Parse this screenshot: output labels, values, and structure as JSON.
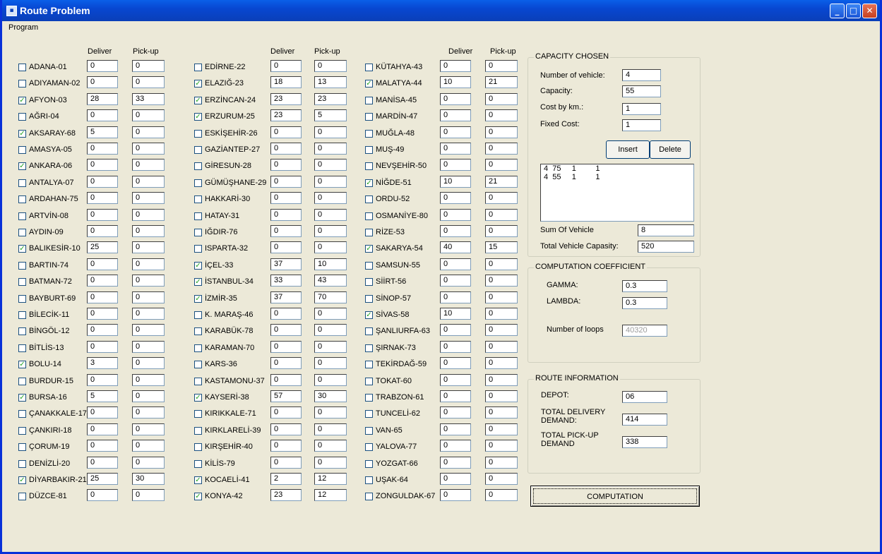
{
  "window": {
    "title": "Route Problem"
  },
  "menu": {
    "program": "Program"
  },
  "headers": {
    "deliver": "Deliver",
    "pickup": "Pick-up"
  },
  "columns": [
    [
      {
        "name": "ADANA-01",
        "checked": false,
        "deliver": "0",
        "pickup": "0"
      },
      {
        "name": "ADIYAMAN-02",
        "checked": false,
        "deliver": "0",
        "pickup": "0"
      },
      {
        "name": "AFYON-03",
        "checked": true,
        "deliver": "28",
        "pickup": "33"
      },
      {
        "name": "AĞRI-04",
        "checked": false,
        "deliver": "0",
        "pickup": "0"
      },
      {
        "name": "AKSARAY-68",
        "checked": true,
        "deliver": "5",
        "pickup": "0"
      },
      {
        "name": "AMASYA-05",
        "checked": false,
        "deliver": "0",
        "pickup": "0"
      },
      {
        "name": "ANKARA-06",
        "checked": true,
        "deliver": "0",
        "pickup": "0"
      },
      {
        "name": "ANTALYA-07",
        "checked": false,
        "deliver": "0",
        "pickup": "0"
      },
      {
        "name": "ARDAHAN-75",
        "checked": false,
        "deliver": "0",
        "pickup": "0"
      },
      {
        "name": "ARTVİN-08",
        "checked": false,
        "deliver": "0",
        "pickup": "0"
      },
      {
        "name": "AYDIN-09",
        "checked": false,
        "deliver": "0",
        "pickup": "0"
      },
      {
        "name": "BALIKESİR-10",
        "checked": true,
        "deliver": "25",
        "pickup": "0"
      },
      {
        "name": "BARTIN-74",
        "checked": false,
        "deliver": "0",
        "pickup": "0"
      },
      {
        "name": "BATMAN-72",
        "checked": false,
        "deliver": "0",
        "pickup": "0"
      },
      {
        "name": "BAYBURT-69",
        "checked": false,
        "deliver": "0",
        "pickup": "0"
      },
      {
        "name": "BİLECİK-11",
        "checked": false,
        "deliver": "0",
        "pickup": "0"
      },
      {
        "name": "BİNGÖL-12",
        "checked": false,
        "deliver": "0",
        "pickup": "0"
      },
      {
        "name": "BİTLİS-13",
        "checked": false,
        "deliver": "0",
        "pickup": "0"
      },
      {
        "name": "BOLU-14",
        "checked": true,
        "deliver": "3",
        "pickup": "0"
      },
      {
        "name": "BURDUR-15",
        "checked": false,
        "deliver": "0",
        "pickup": "0"
      },
      {
        "name": "BURSA-16",
        "checked": true,
        "deliver": "5",
        "pickup": "0"
      },
      {
        "name": "ÇANAKKALE-17",
        "checked": false,
        "deliver": "0",
        "pickup": "0"
      },
      {
        "name": "ÇANKIRI-18",
        "checked": false,
        "deliver": "0",
        "pickup": "0"
      },
      {
        "name": "ÇORUM-19",
        "checked": false,
        "deliver": "0",
        "pickup": "0"
      },
      {
        "name": "DENİZLİ-20",
        "checked": false,
        "deliver": "0",
        "pickup": "0"
      },
      {
        "name": "DİYARBAKIR-21",
        "checked": true,
        "deliver": "25",
        "pickup": "30"
      },
      {
        "name": "DÜZCE-81",
        "checked": false,
        "deliver": "0",
        "pickup": "0"
      }
    ],
    [
      {
        "name": "EDİRNE-22",
        "checked": false,
        "deliver": "0",
        "pickup": "0"
      },
      {
        "name": "ELAZIĞ-23",
        "checked": true,
        "deliver": "18",
        "pickup": "13"
      },
      {
        "name": "ERZİNCAN-24",
        "checked": true,
        "deliver": "23",
        "pickup": "23"
      },
      {
        "name": "ERZURUM-25",
        "checked": true,
        "deliver": "23",
        "pickup": "5"
      },
      {
        "name": "ESKİŞEHİR-26",
        "checked": false,
        "deliver": "0",
        "pickup": "0"
      },
      {
        "name": "GAZİANTEP-27",
        "checked": false,
        "deliver": "0",
        "pickup": "0"
      },
      {
        "name": "GİRESUN-28",
        "checked": false,
        "deliver": "0",
        "pickup": "0"
      },
      {
        "name": "GÜMÜŞHANE-29",
        "checked": false,
        "deliver": "0",
        "pickup": "0"
      },
      {
        "name": "HAKKARİ-30",
        "checked": false,
        "deliver": "0",
        "pickup": "0"
      },
      {
        "name": "HATAY-31",
        "checked": false,
        "deliver": "0",
        "pickup": "0"
      },
      {
        "name": "IĞDIR-76",
        "checked": false,
        "deliver": "0",
        "pickup": "0"
      },
      {
        "name": "ISPARTA-32",
        "checked": false,
        "deliver": "0",
        "pickup": "0"
      },
      {
        "name": "İÇEL-33",
        "checked": true,
        "deliver": "37",
        "pickup": "10"
      },
      {
        "name": "İSTANBUL-34",
        "checked": true,
        "deliver": "33",
        "pickup": "43"
      },
      {
        "name": "İZMİR-35",
        "checked": true,
        "deliver": "37",
        "pickup": "70"
      },
      {
        "name": "K. MARAŞ-46",
        "checked": false,
        "deliver": "0",
        "pickup": "0"
      },
      {
        "name": "KARABÜK-78",
        "checked": false,
        "deliver": "0",
        "pickup": "0"
      },
      {
        "name": "KARAMAN-70",
        "checked": false,
        "deliver": "0",
        "pickup": "0"
      },
      {
        "name": "KARS-36",
        "checked": false,
        "deliver": "0",
        "pickup": "0"
      },
      {
        "name": "KASTAMONU-37",
        "checked": false,
        "deliver": "0",
        "pickup": "0"
      },
      {
        "name": "KAYSERİ-38",
        "checked": true,
        "deliver": "57",
        "pickup": "30"
      },
      {
        "name": "KIRIKKALE-71",
        "checked": false,
        "deliver": "0",
        "pickup": "0"
      },
      {
        "name": "KIRKLARELİ-39",
        "checked": false,
        "deliver": "0",
        "pickup": "0"
      },
      {
        "name": "KIRŞEHİR-40",
        "checked": false,
        "deliver": "0",
        "pickup": "0"
      },
      {
        "name": "KİLİS-79",
        "checked": false,
        "deliver": "0",
        "pickup": "0"
      },
      {
        "name": "KOCAELİ-41",
        "checked": true,
        "deliver": "2",
        "pickup": "12"
      },
      {
        "name": "KONYA-42",
        "checked": true,
        "deliver": "23",
        "pickup": "12"
      }
    ],
    [
      {
        "name": "KÜTAHYA-43",
        "checked": false,
        "deliver": "0",
        "pickup": "0"
      },
      {
        "name": "MALATYA-44",
        "checked": true,
        "deliver": "10",
        "pickup": "21"
      },
      {
        "name": "MANİSA-45",
        "checked": false,
        "deliver": "0",
        "pickup": "0"
      },
      {
        "name": "MARDİN-47",
        "checked": false,
        "deliver": "0",
        "pickup": "0"
      },
      {
        "name": "MUĞLA-48",
        "checked": false,
        "deliver": "0",
        "pickup": "0"
      },
      {
        "name": "MUŞ-49",
        "checked": false,
        "deliver": "0",
        "pickup": "0"
      },
      {
        "name": "NEVŞEHİR-50",
        "checked": false,
        "deliver": "0",
        "pickup": "0"
      },
      {
        "name": "NİĞDE-51",
        "checked": true,
        "deliver": "10",
        "pickup": "21"
      },
      {
        "name": "ORDU-52",
        "checked": false,
        "deliver": "0",
        "pickup": "0"
      },
      {
        "name": "OSMANİYE-80",
        "checked": false,
        "deliver": "0",
        "pickup": "0"
      },
      {
        "name": "RİZE-53",
        "checked": false,
        "deliver": "0",
        "pickup": "0"
      },
      {
        "name": "SAKARYA-54",
        "checked": true,
        "deliver": "40",
        "pickup": "15"
      },
      {
        "name": "SAMSUN-55",
        "checked": false,
        "deliver": "0",
        "pickup": "0"
      },
      {
        "name": "SİİRT-56",
        "checked": false,
        "deliver": "0",
        "pickup": "0"
      },
      {
        "name": "SİNOP-57",
        "checked": false,
        "deliver": "0",
        "pickup": "0"
      },
      {
        "name": "SİVAS-58",
        "checked": true,
        "deliver": "10",
        "pickup": "0"
      },
      {
        "name": "ŞANLIURFA-63",
        "checked": false,
        "deliver": "0",
        "pickup": "0"
      },
      {
        "name": "ŞIRNAK-73",
        "checked": false,
        "deliver": "0",
        "pickup": "0"
      },
      {
        "name": "TEKİRDAĞ-59",
        "checked": false,
        "deliver": "0",
        "pickup": "0"
      },
      {
        "name": "TOKAT-60",
        "checked": false,
        "deliver": "0",
        "pickup": "0"
      },
      {
        "name": "TRABZON-61",
        "checked": false,
        "deliver": "0",
        "pickup": "0"
      },
      {
        "name": "TUNCELİ-62",
        "checked": false,
        "deliver": "0",
        "pickup": "0"
      },
      {
        "name": "VAN-65",
        "checked": false,
        "deliver": "0",
        "pickup": "0"
      },
      {
        "name": "YALOVA-77",
        "checked": false,
        "deliver": "0",
        "pickup": "0"
      },
      {
        "name": "YOZGAT-66",
        "checked": false,
        "deliver": "0",
        "pickup": "0"
      },
      {
        "name": "UŞAK-64",
        "checked": false,
        "deliver": "0",
        "pickup": "0"
      },
      {
        "name": "ZONGULDAK-67",
        "checked": false,
        "deliver": "0",
        "pickup": "0"
      }
    ]
  ],
  "capacity": {
    "legend": "CAPACITY CHOSEN",
    "num_vehicle_label": "Number of vehicle:",
    "num_vehicle": "4",
    "capacity_label": "Capacity:",
    "capacity": "55",
    "cost_label": "Cost by km.:",
    "cost": "1",
    "fixed_label": "Fixed Cost:",
    "fixed": "1",
    "insert": "Insert",
    "delete": "Delete",
    "list": [
      "4  75     1         1",
      "4  55     1         1"
    ],
    "sum_label": "Sum Of Vehicle",
    "sum": "8",
    "total_label": "Total Vehicle Capasity:",
    "total": "520"
  },
  "coef": {
    "legend": "COMPUTATION COEFFICIENT",
    "gamma_label": "GAMMA:",
    "gamma": "0.3",
    "lambda_label": "LAMBDA:",
    "lambda": "0.3",
    "loops_label": "Number of loops",
    "loops": "40320"
  },
  "route": {
    "legend": "ROUTE INFORMATION",
    "depot_label": "DEPOT:",
    "depot": "06",
    "delivery_label_1": "TOTAL DELIVERY",
    "delivery_label_2": "DEMAND:",
    "delivery": "414",
    "pickup_label_1": "TOTAL PICK-UP",
    "pickup_label_2": "DEMAND",
    "pickup": "338"
  },
  "computation": "COMPUTATION"
}
